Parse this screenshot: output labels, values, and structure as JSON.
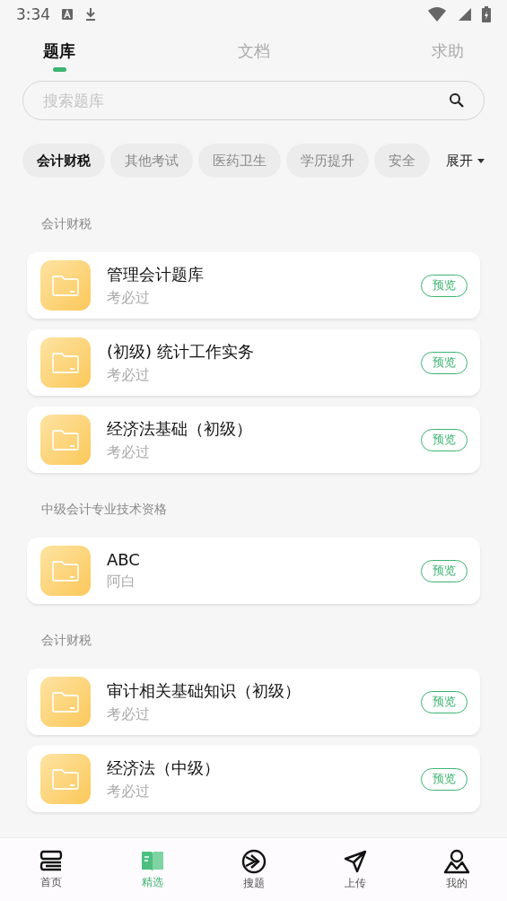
{
  "status_bar": {
    "time": "3:34"
  },
  "tabs": [
    {
      "label": "题库",
      "selected": true
    },
    {
      "label": "文档",
      "selected": false
    },
    {
      "label": "求助",
      "selected": false
    }
  ],
  "search": {
    "placeholder": "搜索题库"
  },
  "chips": [
    {
      "label": "会计财税",
      "selected": true
    },
    {
      "label": "其他考试",
      "selected": false
    },
    {
      "label": "医药卫生",
      "selected": false
    },
    {
      "label": "学历提升",
      "selected": false
    },
    {
      "label": "安全",
      "selected": false
    }
  ],
  "expand_button": "展开",
  "sections": [
    {
      "title": "会计财税",
      "items": [
        {
          "name": "管理会计题库",
          "author": "考必过",
          "action": "预览"
        },
        {
          "name": "(初级) 统计工作实务",
          "author": "考必过",
          "action": "预览"
        },
        {
          "name": "经济法基础（初级）",
          "author": "考必过",
          "action": "预览"
        }
      ]
    },
    {
      "title": "中级会计专业技术资格",
      "items": [
        {
          "name": "ABC",
          "author": "阿白",
          "action": "预览"
        }
      ]
    },
    {
      "title": "会计财税",
      "items": [
        {
          "name": "审计相关基础知识（初级）",
          "author": "考必过",
          "action": "预览"
        },
        {
          "name": "经济法（中级）",
          "author": "考必过",
          "action": "预览"
        }
      ]
    }
  ],
  "bottom_nav": [
    {
      "label": "首页",
      "selected": false,
      "kind": "home"
    },
    {
      "label": "精选",
      "selected": true,
      "kind": "book"
    },
    {
      "label": "搜题",
      "selected": false,
      "kind": "search"
    },
    {
      "label": "上传",
      "selected": false,
      "kind": "send"
    },
    {
      "label": "我的",
      "selected": false,
      "kind": "user"
    }
  ]
}
